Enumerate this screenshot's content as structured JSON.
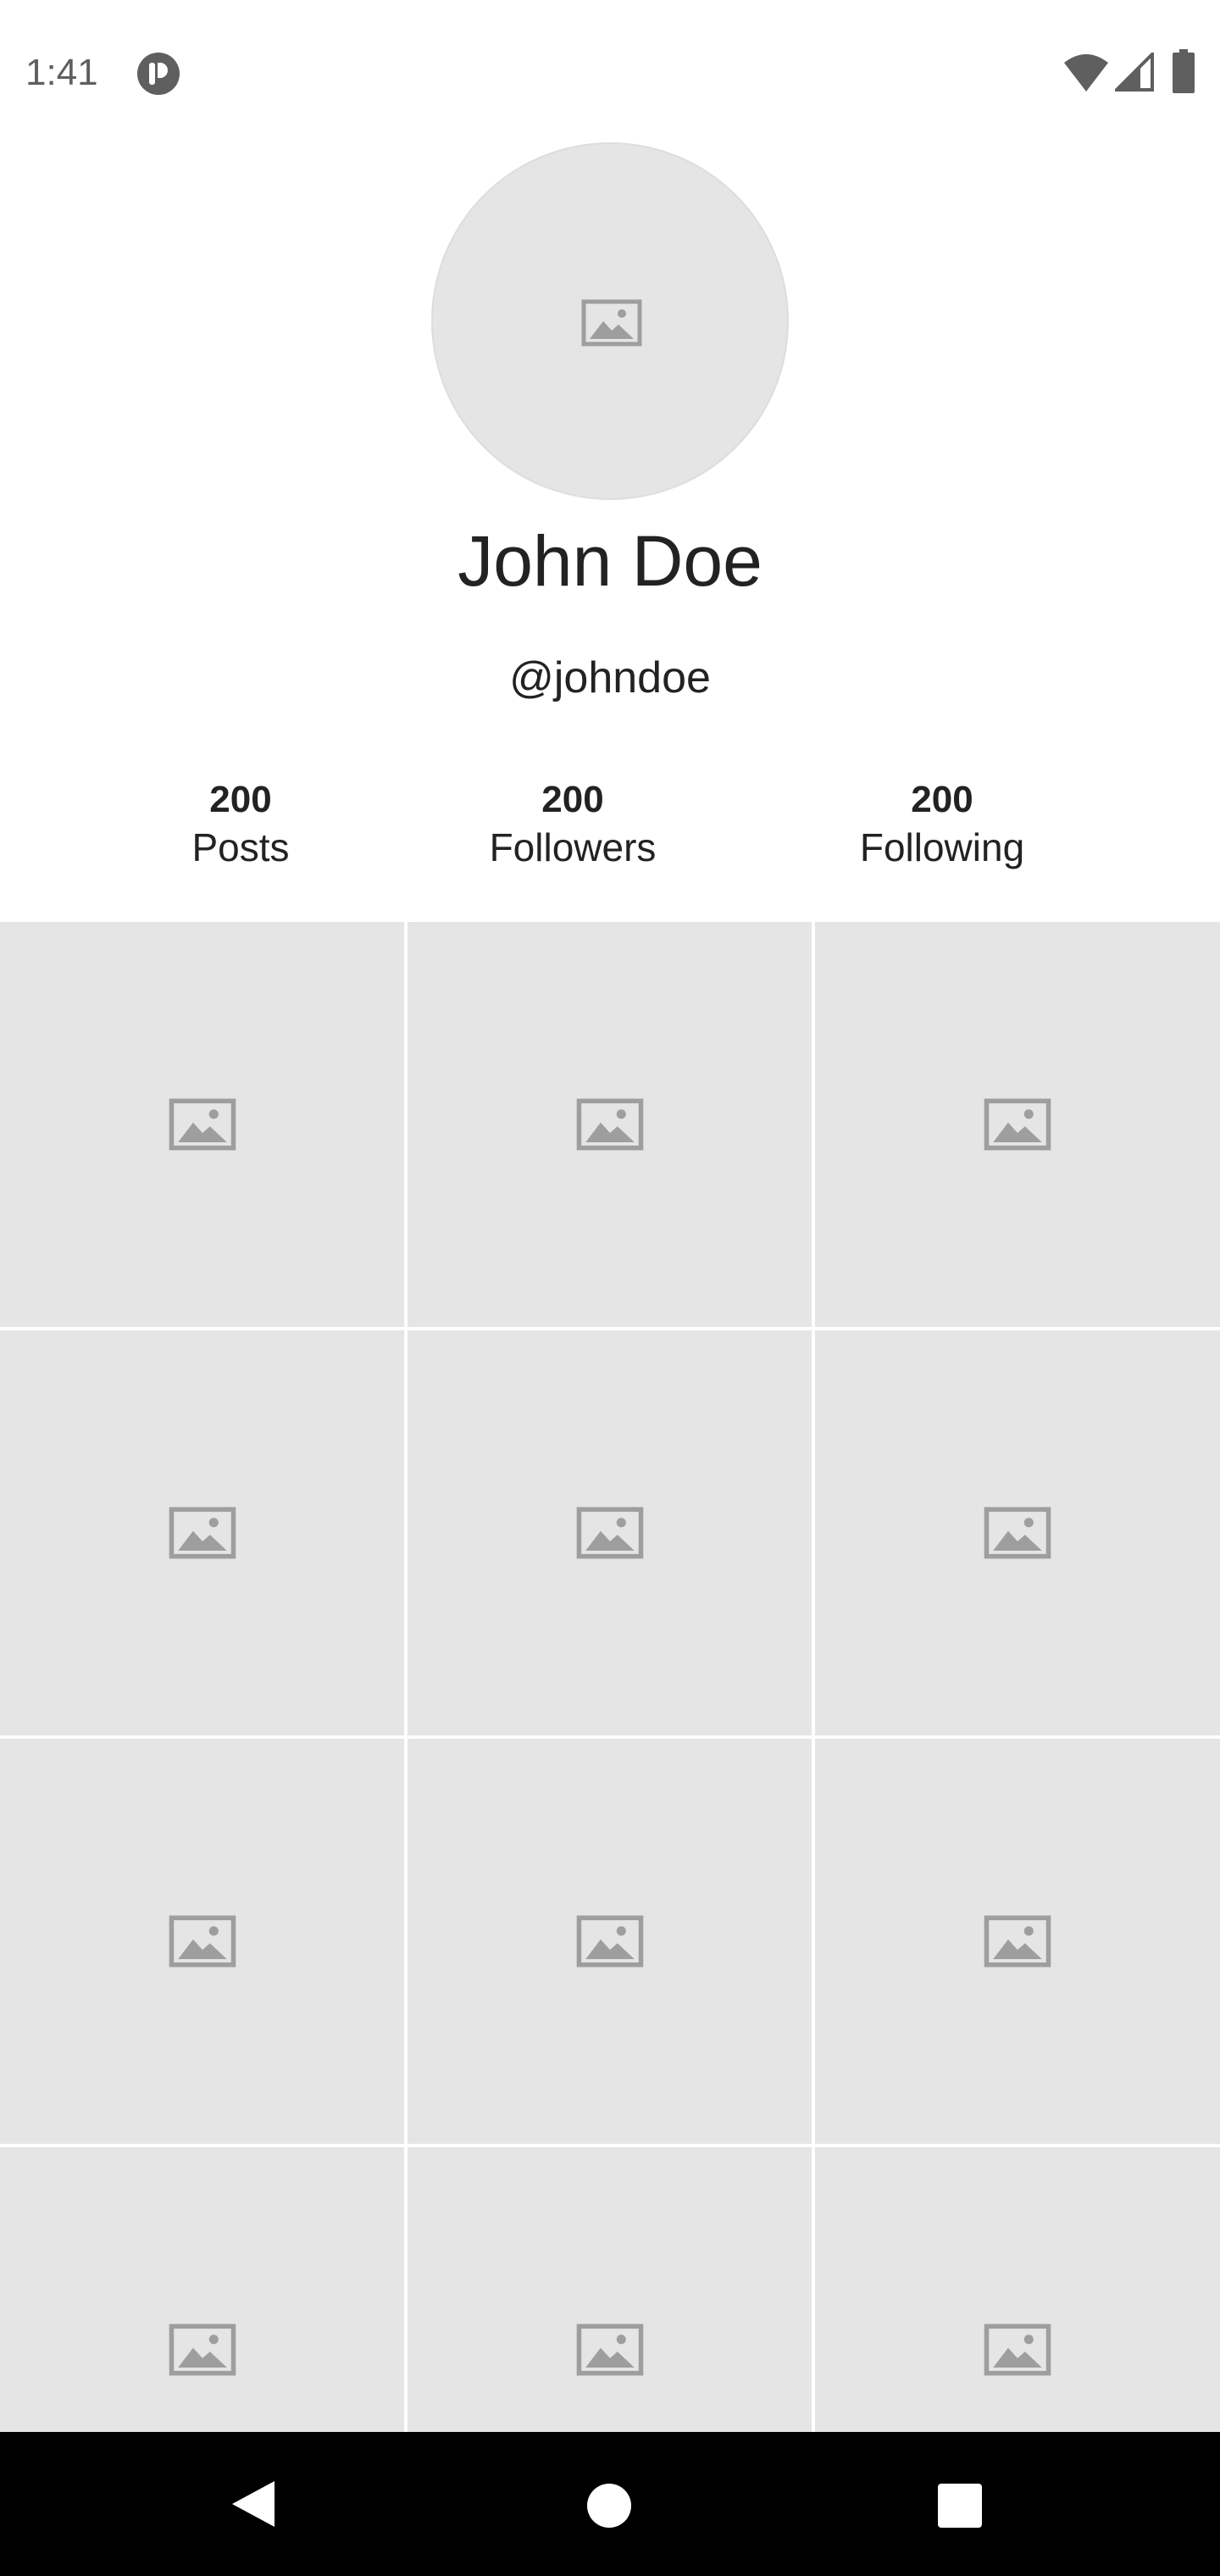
{
  "status_bar": {
    "time": "1:41",
    "icons": [
      "app-notification-icon",
      "wifi-icon",
      "signal-icon",
      "battery-icon"
    ]
  },
  "profile": {
    "avatar_icon": "image-placeholder-icon",
    "name": "John Doe",
    "handle": "@johndoe"
  },
  "stats": [
    {
      "value": "200",
      "label": "Posts"
    },
    {
      "value": "200",
      "label": "Followers"
    },
    {
      "value": "200",
      "label": "Following"
    }
  ],
  "grid": {
    "columns": 3,
    "tile_icon": "image-placeholder-icon",
    "tiles": [
      1,
      2,
      3,
      4,
      5,
      6,
      7,
      8,
      9,
      10,
      11,
      12
    ]
  },
  "nav_bar": {
    "icons": [
      "back-icon",
      "home-icon",
      "recents-icon"
    ]
  },
  "colors": {
    "background": "#ffffff",
    "placeholder": "#e5e5e5",
    "placeholder_icon": "#9e9e9e",
    "text": "#222222",
    "nav_bar": "#000000"
  }
}
